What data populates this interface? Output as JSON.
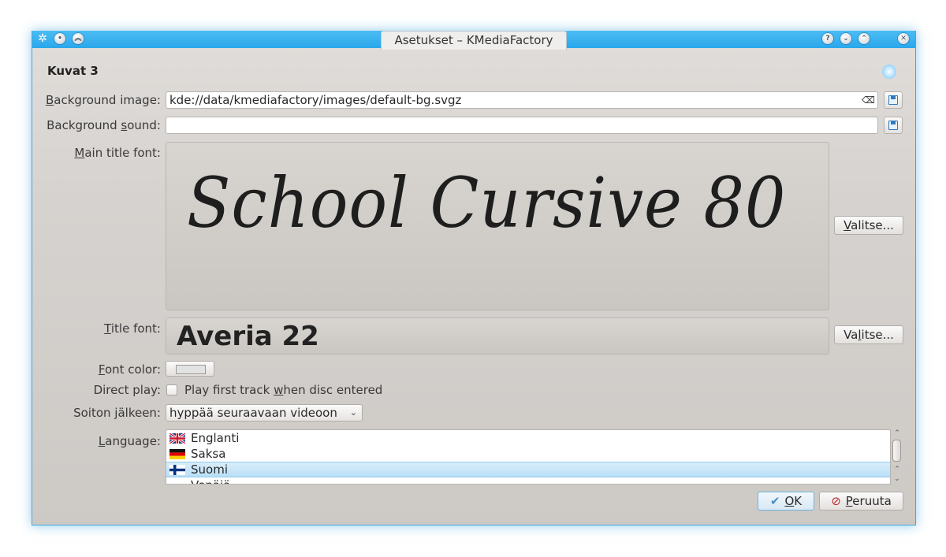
{
  "window": {
    "title": "Asetukset – KMediaFactory",
    "titlebar_buttons": [
      "help-icon",
      "minimize-icon",
      "maximize-icon",
      "close-icon"
    ]
  },
  "section_title": "Kuvat 3",
  "background_image": {
    "label_pre": "",
    "label_mnemonic": "B",
    "label_post": "ackground image:",
    "value": "kde://data/kmediafactory/images/default-bg.svgz"
  },
  "background_sound": {
    "label_pre": "Background ",
    "label_mnemonic": "s",
    "label_post": "ound:",
    "value": ""
  },
  "main_title_font": {
    "label_pre": "",
    "label_mnemonic": "M",
    "label_post": "ain title font:",
    "preview": "School Cursive 80",
    "choose_pre": "",
    "choose_mnemonic": "V",
    "choose_post": "alitse..."
  },
  "title_font": {
    "label_pre": "",
    "label_mnemonic": "T",
    "label_post": "itle font:",
    "preview": "Averia 22",
    "choose_pre": "Va",
    "choose_mnemonic": "l",
    "choose_post": "itse..."
  },
  "font_color": {
    "label_pre": "",
    "label_mnemonic": "F",
    "label_post": "ont color:",
    "swatch": "#e3e3e3"
  },
  "direct_play": {
    "label": "Direct play:",
    "checkbox_pre": "Play first track ",
    "checkbox_mnemonic": "w",
    "checkbox_post": "hen disc entered",
    "checked": false
  },
  "after_play": {
    "label": "Soiton jälkeen:",
    "selected": "hyppää seuraavaan videoon"
  },
  "language": {
    "label_pre": "",
    "label_mnemonic": "L",
    "label_post": "anguage:",
    "items": [
      {
        "name": "Englanti",
        "flag": "uk-flag-icon"
      },
      {
        "name": "Saksa",
        "flag": "germany-flag-icon"
      },
      {
        "name": "Suomi",
        "flag": "finland-flag-icon",
        "selected": true
      },
      {
        "name": "Venäjä",
        "flag": "russia-flag-icon"
      }
    ]
  },
  "buttons": {
    "ok_mnemonic": "O",
    "ok_post": "K",
    "cancel_mnemonic": "P",
    "cancel_post": "eruuta"
  },
  "colors": {
    "titlebar": "#2aa7ea",
    "selection": "#b9dff7",
    "accent_border": "#3ea9e0"
  }
}
